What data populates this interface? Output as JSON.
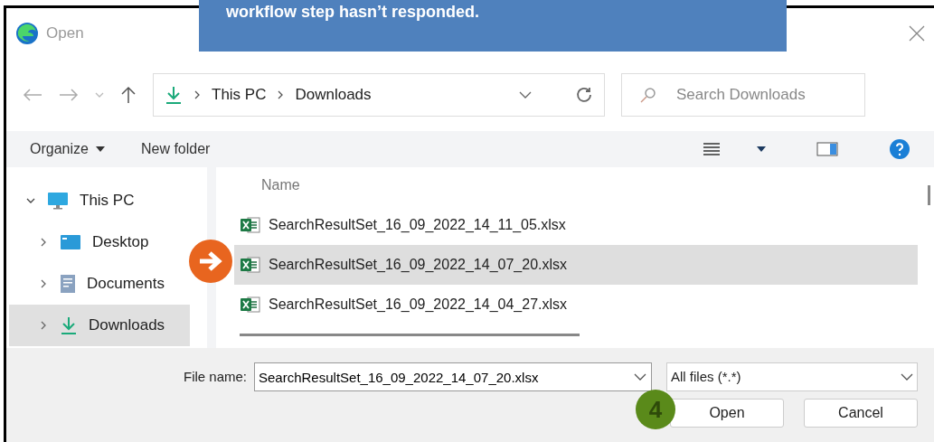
{
  "callout": {
    "text": "workflow step hasn’t responded."
  },
  "window": {
    "title": "Open"
  },
  "breadcrumb": [
    "This PC",
    "Downloads"
  ],
  "search": {
    "placeholder": "Search Downloads"
  },
  "toolbar": {
    "organize": "Organize",
    "new_folder": "New folder"
  },
  "sidebar": {
    "items": [
      {
        "label": "This PC",
        "kind": "pc",
        "expanded": true,
        "selected": false,
        "children": [
          {
            "label": "Desktop",
            "kind": "desktop",
            "expanded": false,
            "selected": false
          },
          {
            "label": "Documents",
            "kind": "documents",
            "expanded": false,
            "selected": false
          },
          {
            "label": "Downloads",
            "kind": "downloads",
            "expanded": false,
            "selected": true
          }
        ]
      }
    ]
  },
  "files": {
    "column": "Name",
    "rows": [
      {
        "name": "SearchResultSet_16_09_2022_14_11_05.xlsx",
        "selected": false
      },
      {
        "name": "SearchResultSet_16_09_2022_14_07_20.xlsx",
        "selected": true
      },
      {
        "name": "SearchResultSet_16_09_2022_14_04_27.xlsx",
        "selected": false
      }
    ]
  },
  "step_badge": "4",
  "footer": {
    "file_name_label": "File name:",
    "file_name": "SearchResultSet_16_09_2022_14_07_20.xlsx",
    "file_type": "All files (*.*)",
    "buttons": [
      "Open",
      "Cancel"
    ]
  }
}
